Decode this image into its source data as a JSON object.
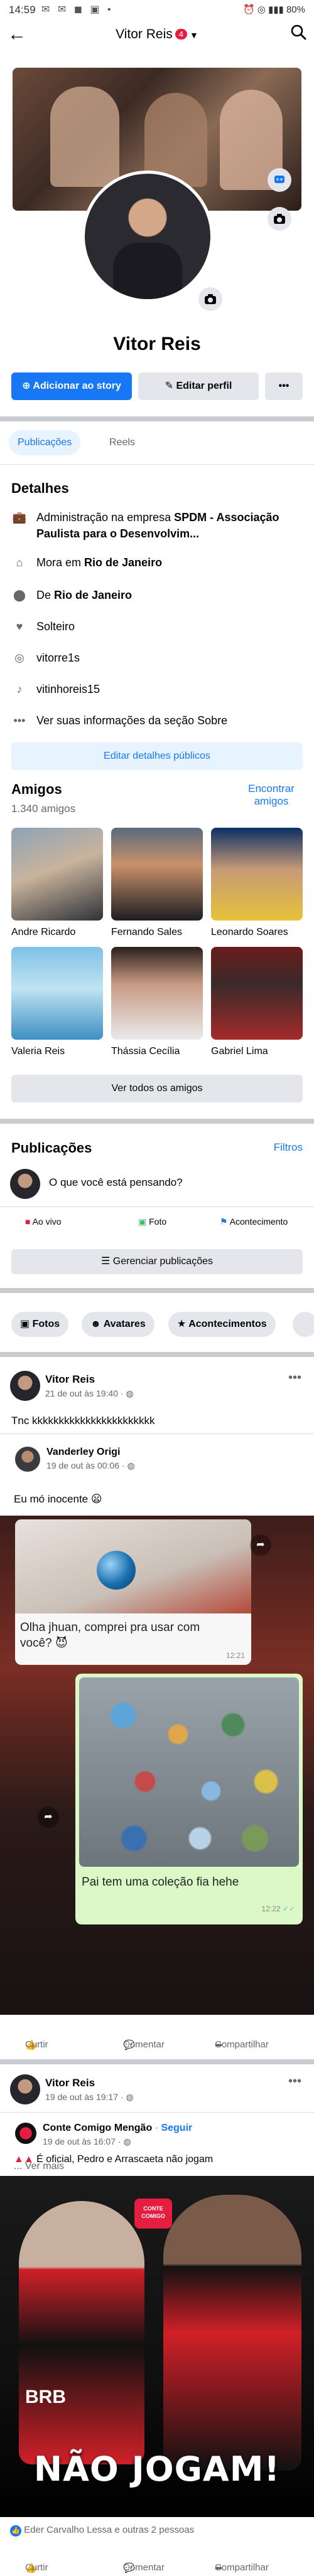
{
  "status": {
    "time": "14:59",
    "battery": "80%"
  },
  "header": {
    "name": "Vitor Reis",
    "badge": "4"
  },
  "profile": {
    "name": "Vitor Reis",
    "add_story": "Adicionar ao story",
    "edit_profile": "Editar perfil",
    "more": "•••"
  },
  "tabs": {
    "posts": "Publicações",
    "reels": "Reels"
  },
  "details": {
    "title": "Detalhes",
    "work_prefix": "Administração na empresa ",
    "work_bold": "SPDM - Associação Paulista para o Desenvolvim...",
    "lives_prefix": "Mora em ",
    "lives_city": "Rio de Janeiro",
    "from_prefix": "De ",
    "from_city": "Rio de Janeiro",
    "relationship": "Solteiro",
    "instagram": "vitorre1s",
    "tiktok": "vitinhoreis15",
    "see_about": "Ver suas informações da seção Sobre",
    "edit_button": "Editar detalhes públicos"
  },
  "friends": {
    "title": "Amigos",
    "count": "1.340 amigos",
    "find_line1": "Encontrar",
    "find_line2": "amigos",
    "list": [
      {
        "name": "Andre Ricardo"
      },
      {
        "name": "Fernando Sales"
      },
      {
        "name": "Leonardo Soares"
      },
      {
        "name": "Valeria Reis"
      },
      {
        "name": "Thássia Cecília"
      },
      {
        "name": "Gabriel Lima"
      }
    ],
    "see_all": "Ver todos os amigos"
  },
  "publications": {
    "title": "Publicações",
    "filters": "Filtros",
    "composer_placeholder": "O que você está pensando?",
    "live": "Ao vivo",
    "photo": "Foto",
    "event": "Acontecimento",
    "manage": "Gerenciar publicações",
    "chips": [
      "Fotos",
      "Avatares",
      "Acontecimentos"
    ]
  },
  "post1": {
    "author": "Vitor Reis",
    "time": "21 de out às 19:40",
    "text": "Tnc kkkkkkkkkkkkkkkkkkkkkkk",
    "shared_author": "Vanderley Origi",
    "shared_time": "19 de out às 00:06",
    "shared_text": "Eu mó inocente",
    "chat1": "Olha jhuan, comprei pra usar com você? 😈",
    "chat1_time": "12:21",
    "chat2": "Pai tem uma coleção fia hehe",
    "chat2_time": "12:22",
    "like": "Curtir",
    "comment": "Comentar",
    "share": "Compartilhar"
  },
  "post2": {
    "author": "Vitor Reis",
    "time": "19 de out às 19:17",
    "page_name": "Conte Comigo Mengão",
    "follow": "Seguir",
    "page_time": "19 de out às 16:07",
    "text": "É oficial, Pedro e Arrascaeta não jogam",
    "see_more": "... Ver mais",
    "image_caption": "NÃO JOGAM!",
    "reactions": "Eder Carvalho Lessa e outras 2 pessoas",
    "like": "Curtir",
    "comment": "Comentar",
    "share": "Compartilhar"
  },
  "colors": {
    "primary": "#1877f2",
    "light_blue": "#e7f3ff",
    "gray_button": "#e4e6eb",
    "badge_red": "#e41e3f"
  }
}
